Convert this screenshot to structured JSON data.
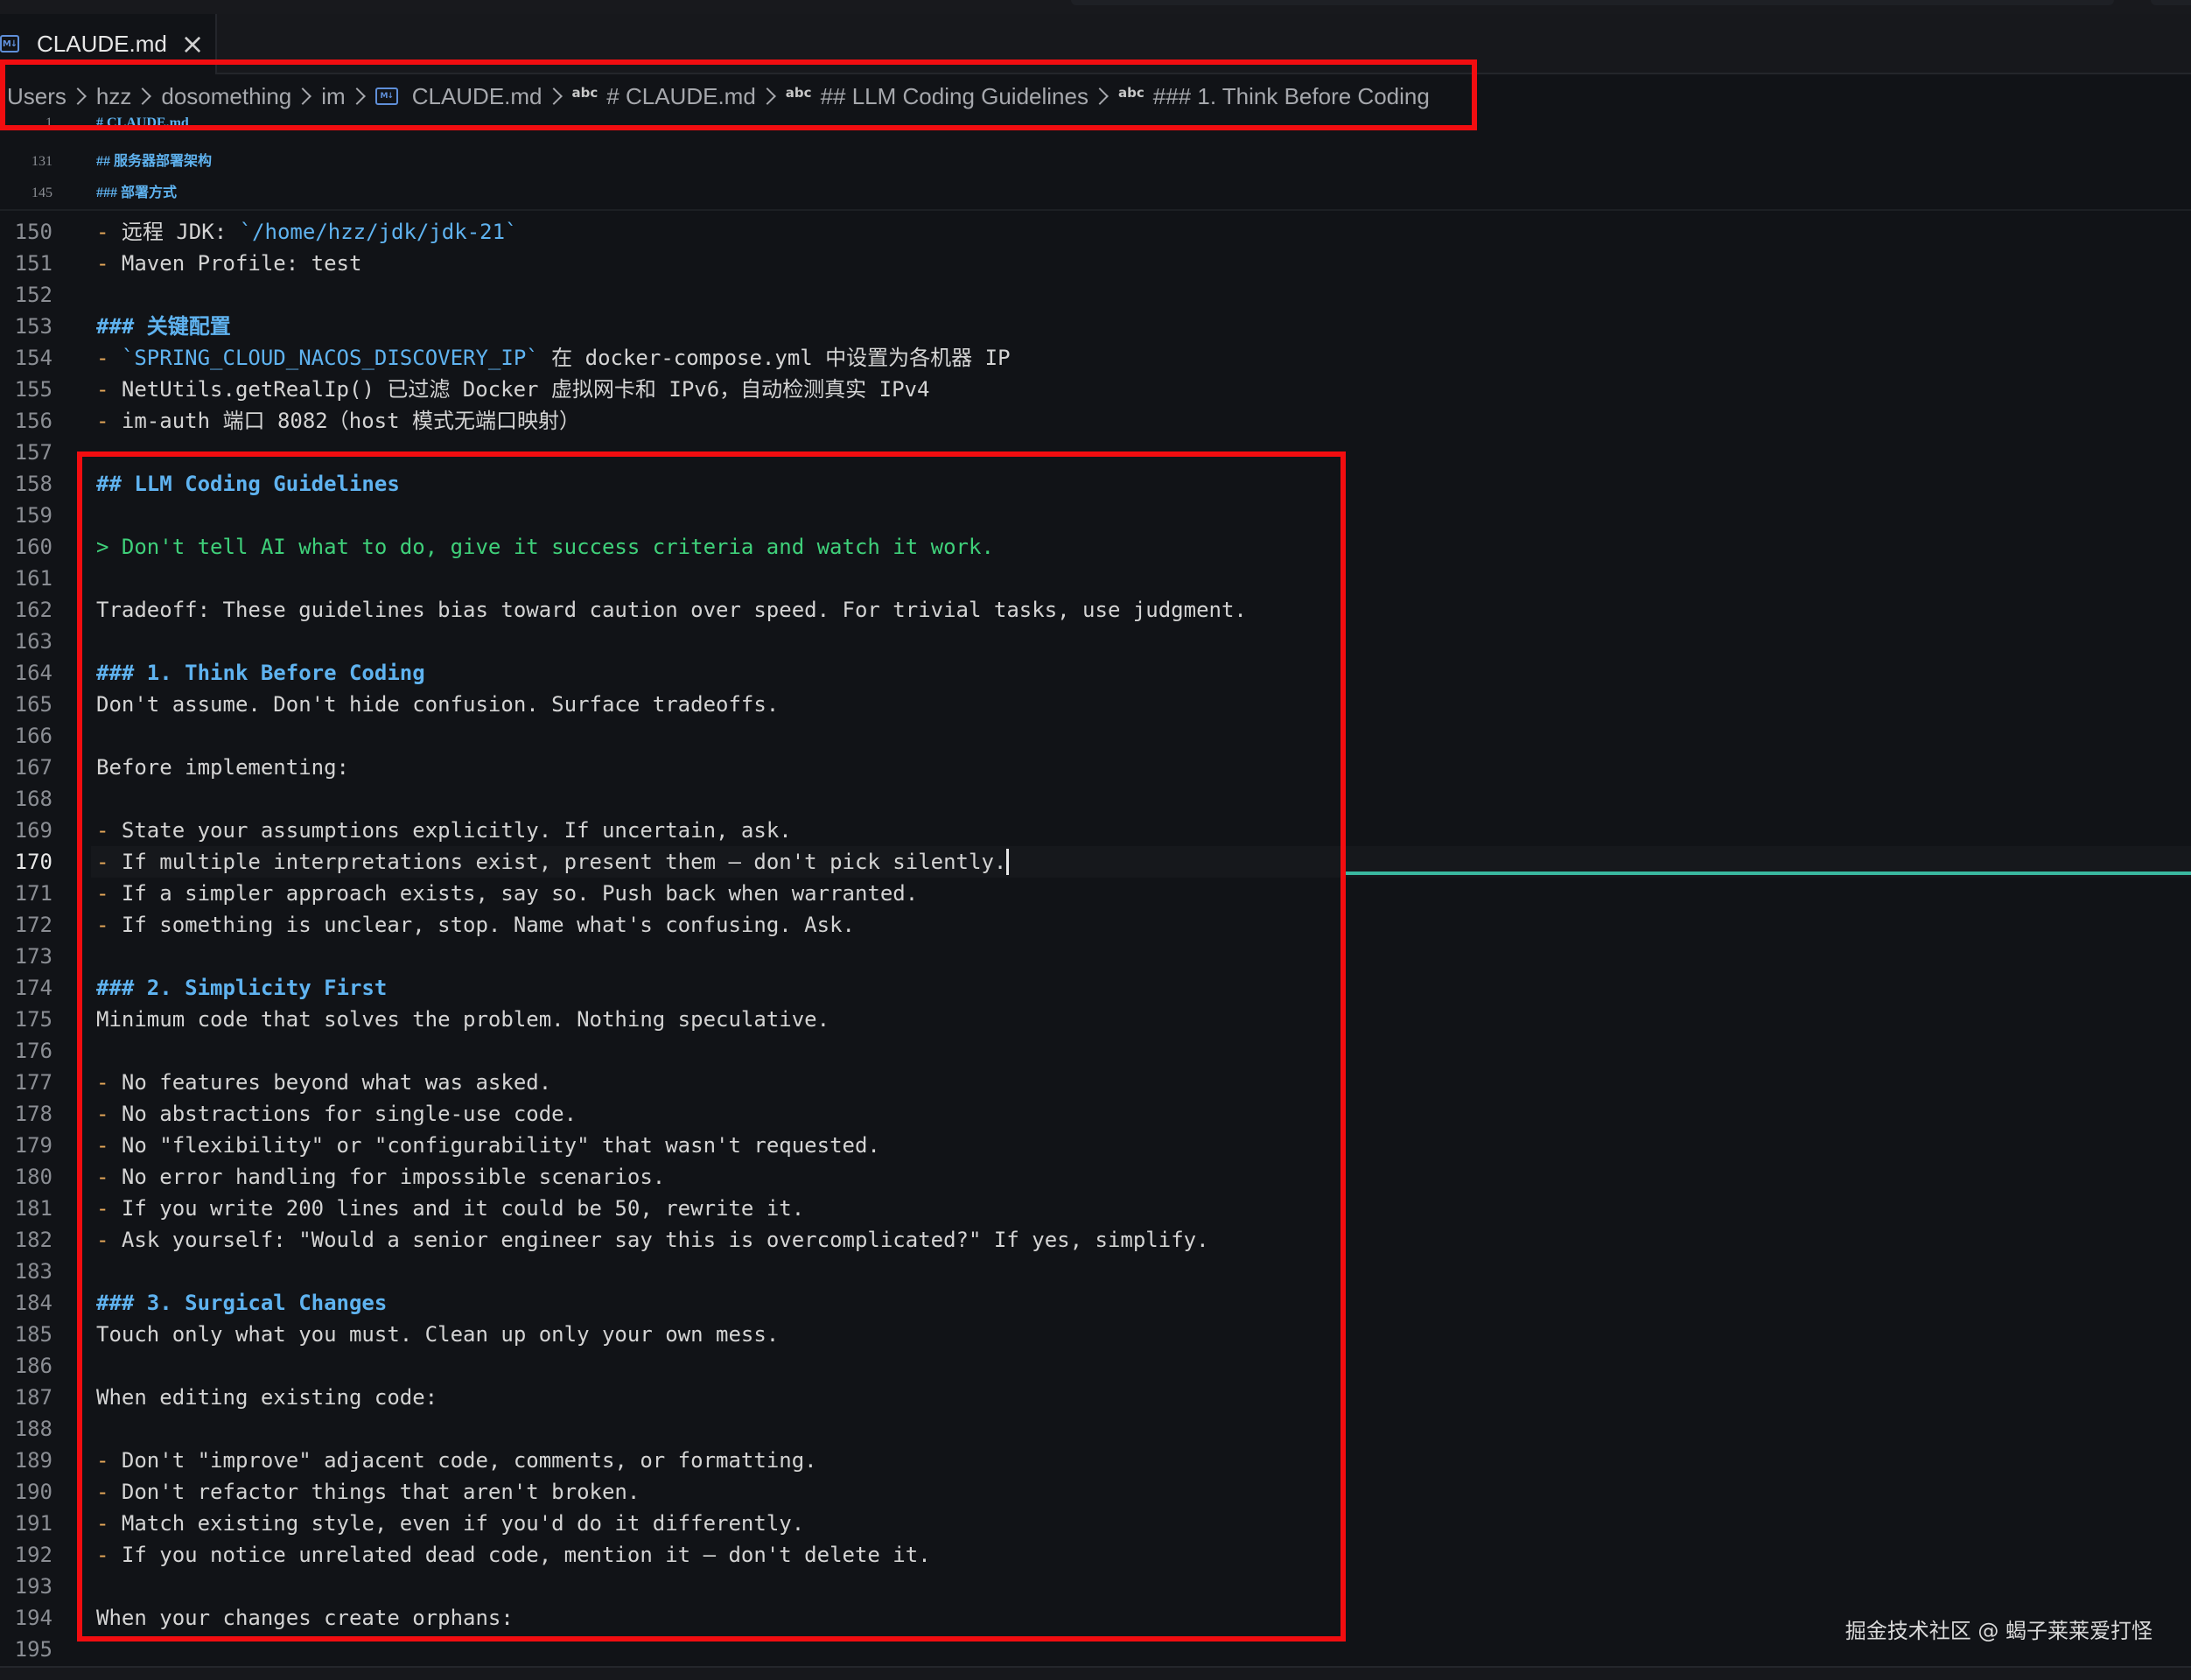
{
  "tab": {
    "label": "CLAUDE.md",
    "icon": "markdown-file-icon",
    "close": "×"
  },
  "breadcrumbs": {
    "items": [
      {
        "label": "Users"
      },
      {
        "label": "hzz"
      },
      {
        "label": "dosomething"
      },
      {
        "label": "im"
      },
      {
        "label": "CLAUDE.md",
        "icon": "markdown-file-icon"
      },
      {
        "label": "# CLAUDE.md",
        "icon": "abc-symbol-icon"
      },
      {
        "label": "## LLM Coding Guidelines",
        "icon": "abc-symbol-icon"
      },
      {
        "label": "### 1. Think Before Coding",
        "icon": "abc-symbol-icon"
      }
    ],
    "abc": "abc"
  },
  "sticky": [
    {
      "num": "1",
      "text": "# CLAUDE.md"
    },
    {
      "num": "131",
      "text": "## 服务器部署架构"
    },
    {
      "num": "145",
      "text": "### 部署方式"
    }
  ],
  "editor": {
    "active_line": "170",
    "lines": [
      {
        "num": "150",
        "kind": "bullet-code",
        "pre": "远程 JDK: ",
        "code": "`/home/hzz/jdk/jdk-21`",
        "post": ""
      },
      {
        "num": "151",
        "kind": "bullet",
        "text": "Maven Profile: test"
      },
      {
        "num": "152",
        "kind": "blank",
        "text": ""
      },
      {
        "num": "153",
        "kind": "heading",
        "text": "### 关键配置"
      },
      {
        "num": "154",
        "kind": "bullet-code",
        "pre": "",
        "code": "`SPRING_CLOUD_NACOS_DISCOVERY_IP`",
        "post": " 在 docker-compose.yml 中设置为各机器 IP"
      },
      {
        "num": "155",
        "kind": "bullet",
        "text": "NetUtils.getRealIp() 已过滤 Docker 虚拟网卡和 IPv6，自动检测真实 IPv4"
      },
      {
        "num": "156",
        "kind": "bullet",
        "text": "im-auth 端口 8082（host 模式无端口映射）"
      },
      {
        "num": "157",
        "kind": "blank",
        "text": ""
      },
      {
        "num": "158",
        "kind": "heading",
        "text": "## LLM Coding Guidelines"
      },
      {
        "num": "159",
        "kind": "blank",
        "text": ""
      },
      {
        "num": "160",
        "kind": "quote",
        "text": "> Don't tell AI what to do, give it success criteria and watch it work."
      },
      {
        "num": "161",
        "kind": "blank",
        "text": ""
      },
      {
        "num": "162",
        "kind": "text",
        "text": "Tradeoff: These guidelines bias toward caution over speed. For trivial tasks, use judgment."
      },
      {
        "num": "163",
        "kind": "blank",
        "text": ""
      },
      {
        "num": "164",
        "kind": "heading",
        "text": "### 1. Think Before Coding"
      },
      {
        "num": "165",
        "kind": "text",
        "text": "Don't assume. Don't hide confusion. Surface tradeoffs."
      },
      {
        "num": "166",
        "kind": "blank",
        "text": ""
      },
      {
        "num": "167",
        "kind": "text",
        "text": "Before implementing:"
      },
      {
        "num": "168",
        "kind": "blank",
        "text": ""
      },
      {
        "num": "169",
        "kind": "bullet",
        "text": "State your assumptions explicitly. If uncertain, ask."
      },
      {
        "num": "170",
        "kind": "bullet",
        "text": "If multiple interpretations exist, present them – don't pick silently."
      },
      {
        "num": "171",
        "kind": "bullet",
        "text": "If a simpler approach exists, say so. Push back when warranted."
      },
      {
        "num": "172",
        "kind": "bullet",
        "text": "If something is unclear, stop. Name what's confusing. Ask."
      },
      {
        "num": "173",
        "kind": "blank",
        "text": ""
      },
      {
        "num": "174",
        "kind": "heading",
        "text": "### 2. Simplicity First"
      },
      {
        "num": "175",
        "kind": "text",
        "text": "Minimum code that solves the problem. Nothing speculative."
      },
      {
        "num": "176",
        "kind": "blank",
        "text": ""
      },
      {
        "num": "177",
        "kind": "bullet",
        "text": "No features beyond what was asked."
      },
      {
        "num": "178",
        "kind": "bullet",
        "text": "No abstractions for single-use code."
      },
      {
        "num": "179",
        "kind": "bullet",
        "text": "No \"flexibility\" or \"configurability\" that wasn't requested."
      },
      {
        "num": "180",
        "kind": "bullet",
        "text": "No error handling for impossible scenarios."
      },
      {
        "num": "181",
        "kind": "bullet",
        "text": "If you write 200 lines and it could be 50, rewrite it."
      },
      {
        "num": "182",
        "kind": "bullet",
        "text": "Ask yourself: \"Would a senior engineer say this is overcomplicated?\" If yes, simplify."
      },
      {
        "num": "183",
        "kind": "blank",
        "text": ""
      },
      {
        "num": "184",
        "kind": "heading",
        "text": "### 3. Surgical Changes"
      },
      {
        "num": "185",
        "kind": "text",
        "text": "Touch only what you must. Clean up only your own mess."
      },
      {
        "num": "186",
        "kind": "blank",
        "text": ""
      },
      {
        "num": "187",
        "kind": "text",
        "text": "When editing existing code:"
      },
      {
        "num": "188",
        "kind": "blank",
        "text": ""
      },
      {
        "num": "189",
        "kind": "bullet",
        "text": "Don't \"improve\" adjacent code, comments, or formatting."
      },
      {
        "num": "190",
        "kind": "bullet",
        "text": "Don't refactor things that aren't broken."
      },
      {
        "num": "191",
        "kind": "bullet",
        "text": "Match existing style, even if you'd do it differently."
      },
      {
        "num": "192",
        "kind": "bullet",
        "text": "If you notice unrelated dead code, mention it – don't delete it."
      },
      {
        "num": "193",
        "kind": "blank",
        "text": ""
      },
      {
        "num": "194",
        "kind": "text",
        "text": "When your changes create orphans:"
      },
      {
        "num": "195",
        "kind": "blank",
        "text": ""
      }
    ]
  },
  "watermark": "掘金技术社区 @ 蝎子莱莱爱打怪",
  "colors": {
    "background": "#111317",
    "heading": "#5fb3f0",
    "bullet_dash": "#e6a85a",
    "blockquote": "#3fd07a",
    "annotation_box": "#f20d10",
    "cursor_marker": "#3ab8a0"
  }
}
